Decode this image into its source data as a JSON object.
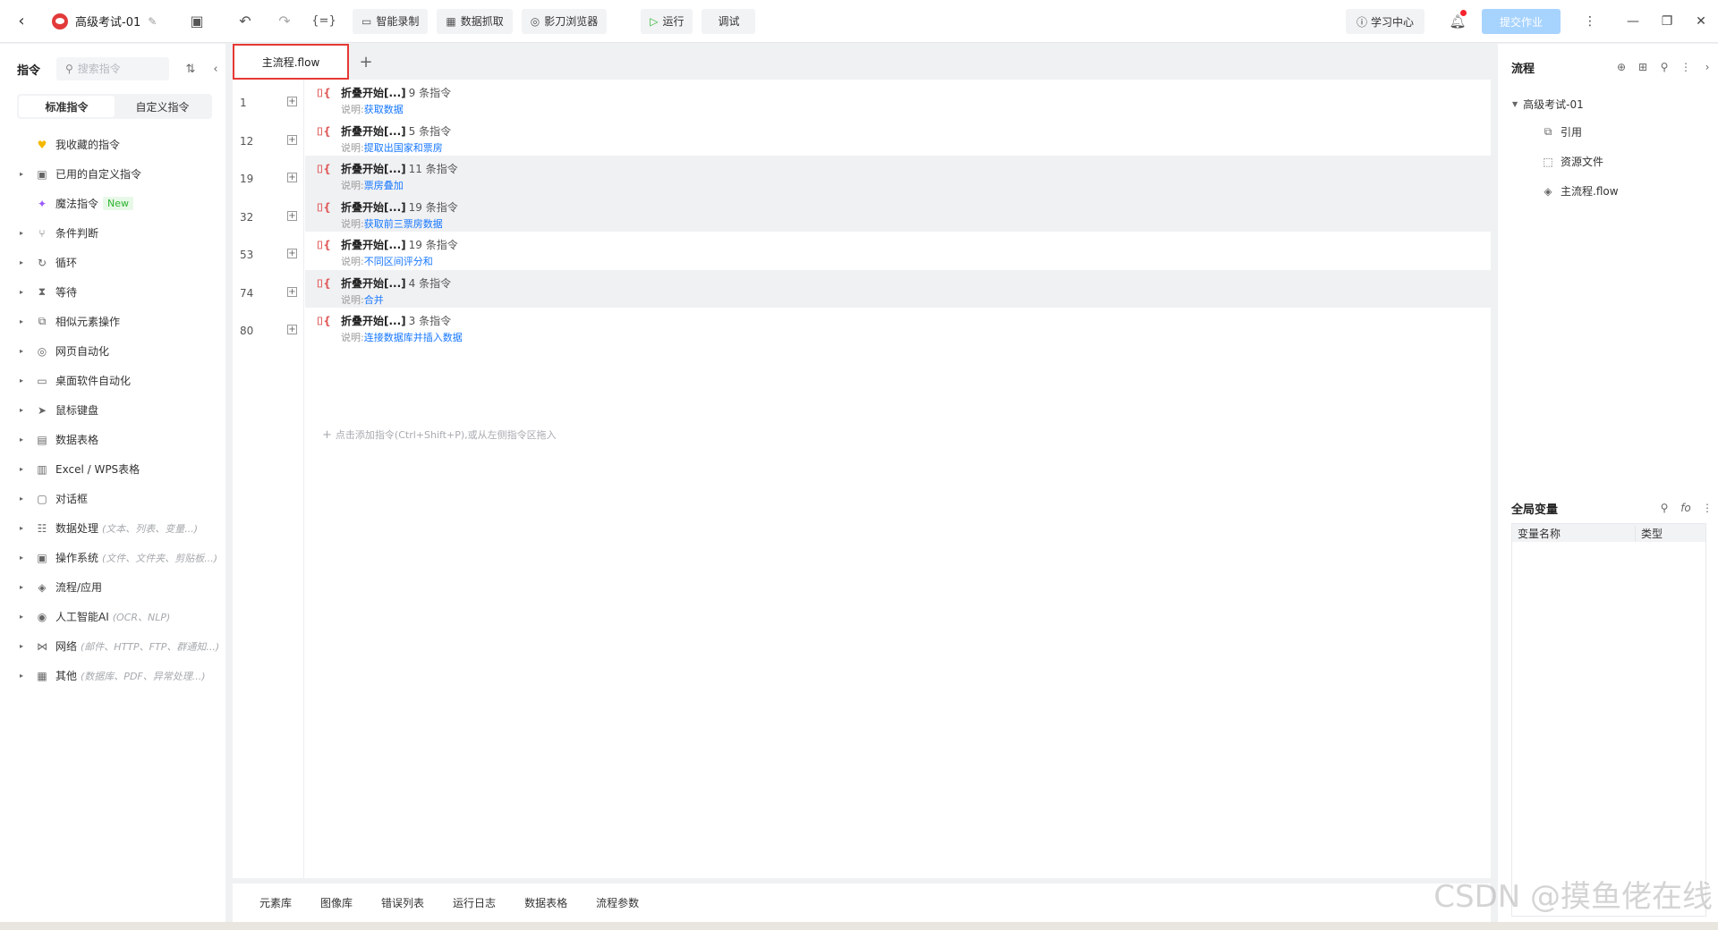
{
  "titlebar": {
    "project_name": "高级考试-01",
    "buttons": [
      "智能录制",
      "数据抓取",
      "影刀浏览器"
    ],
    "run_label": "运行",
    "debug_label": "调试",
    "learn_label": "学习中心",
    "submit_label": "提交作业"
  },
  "left_panel": {
    "title": "指令",
    "search_placeholder": "搜索指令",
    "tabs": [
      "标准指令",
      "自定义指令"
    ],
    "items": [
      {
        "label": "我收藏的指令",
        "hint": "",
        "icon": "heart-icon"
      },
      {
        "label": "已用的自定义指令",
        "hint": "",
        "icon": "calendar-icon"
      },
      {
        "label": "魔法指令",
        "hint": "",
        "badge": "New",
        "icon": "sparkle-icon"
      },
      {
        "label": "条件判断",
        "hint": "",
        "icon": "branch-icon"
      },
      {
        "label": "循环",
        "hint": "",
        "icon": "loop-icon"
      },
      {
        "label": "等待",
        "hint": "",
        "icon": "hourglass-icon"
      },
      {
        "label": "相似元素操作",
        "hint": "",
        "icon": "copy-icon"
      },
      {
        "label": "网页自动化",
        "hint": "",
        "icon": "browser-icon"
      },
      {
        "label": "桌面软件自动化",
        "hint": "",
        "icon": "monitor-icon"
      },
      {
        "label": "鼠标键盘",
        "hint": "",
        "icon": "cursor-icon"
      },
      {
        "label": "数据表格",
        "hint": "",
        "icon": "document-icon"
      },
      {
        "label": "Excel / WPS表格",
        "hint": "",
        "icon": "excel-icon"
      },
      {
        "label": "对话框",
        "hint": "",
        "icon": "dialog-icon"
      },
      {
        "label": "数据处理",
        "hint": "(文本、列表、变量...)",
        "icon": "data-icon"
      },
      {
        "label": "操作系统",
        "hint": "(文件、文件夹、剪贴板...)",
        "icon": "os-icon"
      },
      {
        "label": "流程/应用",
        "hint": "",
        "icon": "layers-icon"
      },
      {
        "label": "人工智能AI",
        "hint": "(OCR、NLP)",
        "icon": "ai-icon"
      },
      {
        "label": "网络",
        "hint": "(邮件、HTTP、FTP、群通知...)",
        "icon": "network-icon"
      },
      {
        "label": "其他",
        "hint": "(数据库、PDF、异常处理...)",
        "icon": "grid-icon"
      }
    ]
  },
  "editor": {
    "tab_label": "主流程.flow",
    "blocks": [
      {
        "line": "1",
        "title": "折叠开始[...]",
        "count": "9 条指令",
        "desc_prefix": "说明:",
        "desc": "获取数据"
      },
      {
        "line": "12",
        "title": "折叠开始[...]",
        "count": "5 条指令",
        "desc_prefix": "说明:",
        "desc": "提取出国家和票房"
      },
      {
        "line": "19",
        "title": "折叠开始[...]",
        "count": "11 条指令",
        "desc_prefix": "说明:",
        "desc": "票房叠加"
      },
      {
        "line": "32",
        "title": "折叠开始[...]",
        "count": "19 条指令",
        "desc_prefix": "说明:",
        "desc": "获取前三票房数据"
      },
      {
        "line": "53",
        "title": "折叠开始[...]",
        "count": "19 条指令",
        "desc_prefix": "说明:",
        "desc": "不同区间评分和"
      },
      {
        "line": "74",
        "title": "折叠开始[...]",
        "count": "4 条指令",
        "desc_prefix": "说明:",
        "desc": "合并"
      },
      {
        "line": "80",
        "title": "折叠开始[...]",
        "count": "3 条指令",
        "desc_prefix": "说明:",
        "desc": "连接数据库并插入数据"
      }
    ],
    "add_hint": "点击添加指令(Ctrl+Shift+P),或从左侧指令区拖入"
  },
  "bottom_tabs": [
    "元素库",
    "图像库",
    "错误列表",
    "运行日志",
    "数据表格",
    "流程参数"
  ],
  "right_panel": {
    "flow_title": "流程",
    "project_node": "高级考试-01",
    "children": [
      {
        "label": "引用",
        "icon": "reference-icon"
      },
      {
        "label": "资源文件",
        "icon": "folder-icon"
      },
      {
        "label": "主流程.flow",
        "icon": "layers-icon"
      }
    ],
    "vars_title": "全局变量",
    "var_columns": [
      "变量名称",
      "类型"
    ]
  },
  "watermark": "CSDN @摸鱼佬在线"
}
